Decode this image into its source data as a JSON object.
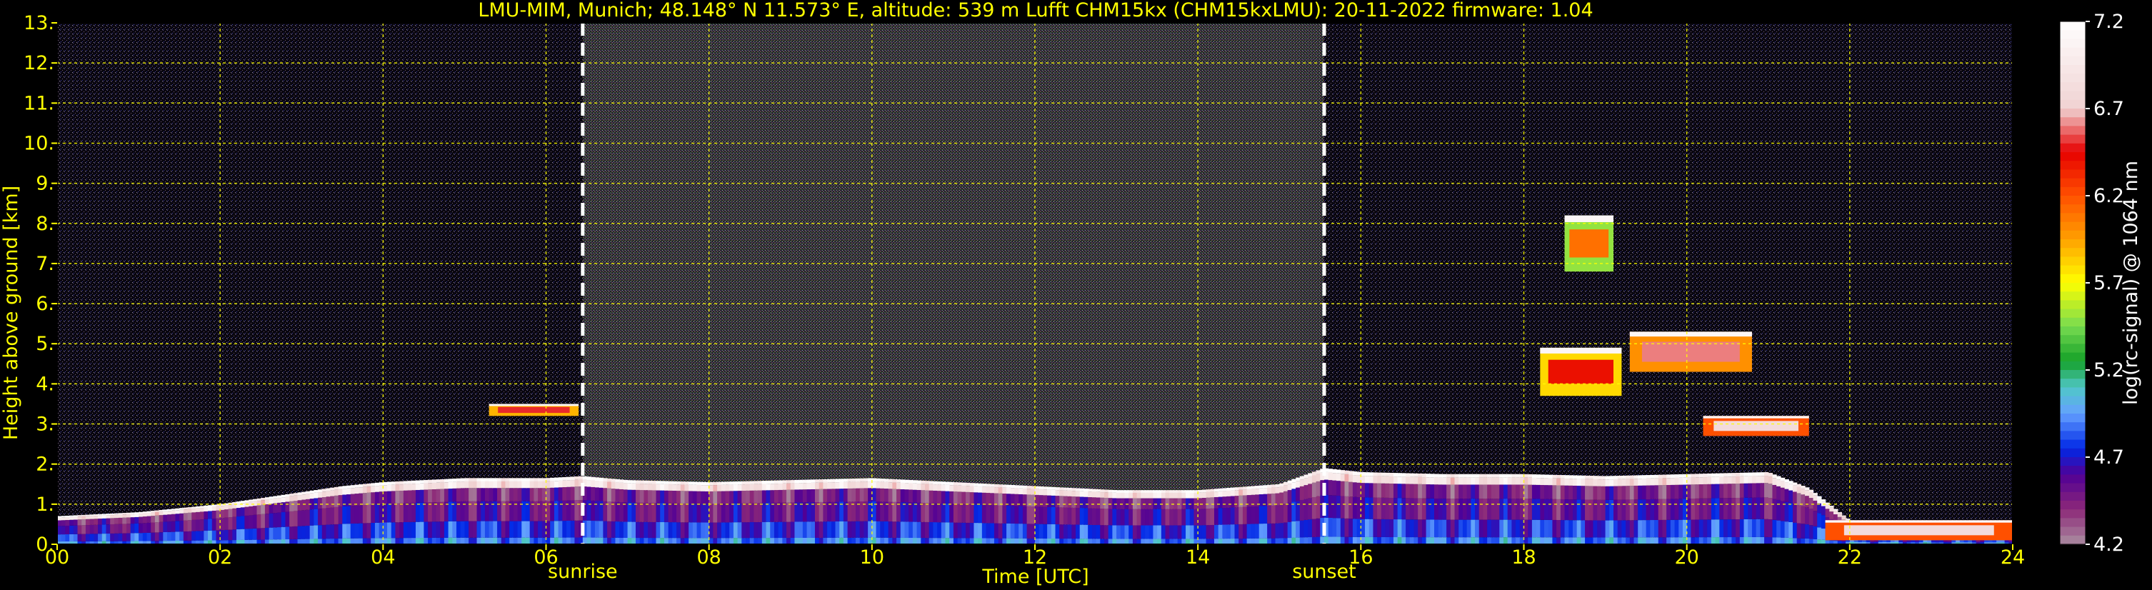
{
  "chart_data": {
    "type": "heatmap",
    "title": "LMU-MIM, Munich; 48.148° N 11.573° E, altitude: 539 m    Lufft CHM15kx (CHM15kxLMU): 20-11-2022    firmware: 1.04",
    "xlabel": "Time [UTC]",
    "ylabel": "Height above ground [km]",
    "colorbar_label": "log(rc-signal) @ 1064 nm",
    "xlim": [
      0,
      24
    ],
    "ylim": [
      0,
      13
    ],
    "x_ticks": [
      "00",
      "02",
      "04",
      "06",
      "08",
      "10",
      "12",
      "14",
      "16",
      "18",
      "20",
      "22",
      "24"
    ],
    "y_ticks": [
      "0.",
      "1.",
      "2.",
      "3.",
      "4.",
      "5.",
      "6.",
      "7.",
      "8.",
      "9.",
      "10.",
      "11.",
      "12.",
      "13."
    ],
    "colorbar_ticks": [
      "7.2",
      "6.7",
      "6.2",
      "5.7",
      "5.2",
      "4.7",
      "4.2"
    ],
    "colorbar_range": [
      4.2,
      7.2
    ],
    "grid": true,
    "events": [
      {
        "label": "sunrise",
        "time": 6.45
      },
      {
        "label": "sunset",
        "time": 15.55
      }
    ],
    "boundary_layer_top_km": [
      [
        0.0,
        0.7
      ],
      [
        0.5,
        0.75
      ],
      [
        1.0,
        0.8
      ],
      [
        1.5,
        0.9
      ],
      [
        2.0,
        1.0
      ],
      [
        2.5,
        1.15
      ],
      [
        3.0,
        1.3
      ],
      [
        3.5,
        1.45
      ],
      [
        4.0,
        1.55
      ],
      [
        5.0,
        1.65
      ],
      [
        6.0,
        1.65
      ],
      [
        6.45,
        1.7
      ],
      [
        7.0,
        1.6
      ],
      [
        8.0,
        1.55
      ],
      [
        9.0,
        1.6
      ],
      [
        10.0,
        1.65
      ],
      [
        11.0,
        1.55
      ],
      [
        12.0,
        1.45
      ],
      [
        13.0,
        1.35
      ],
      [
        14.0,
        1.35
      ],
      [
        15.0,
        1.5
      ],
      [
        15.55,
        1.9
      ],
      [
        16.0,
        1.8
      ],
      [
        17.0,
        1.75
      ],
      [
        18.0,
        1.75
      ],
      [
        19.0,
        1.7
      ],
      [
        20.0,
        1.75
      ],
      [
        21.0,
        1.8
      ],
      [
        21.5,
        1.4
      ],
      [
        22.0,
        0.6
      ],
      [
        23.0,
        0.5
      ],
      [
        24.0,
        0.5
      ]
    ],
    "cloud_layers": [
      {
        "t_start": 5.3,
        "t_end": 6.4,
        "base_km": 3.2,
        "top_km": 3.5,
        "level": 6.5
      },
      {
        "t_start": 18.2,
        "t_end": 19.2,
        "base_km": 3.7,
        "top_km": 4.9,
        "level": 6.4
      },
      {
        "t_start": 19.3,
        "t_end": 20.8,
        "base_km": 4.3,
        "top_km": 5.3,
        "level": 6.6
      },
      {
        "t_start": 20.2,
        "t_end": 21.5,
        "base_km": 2.7,
        "top_km": 3.2,
        "level": 6.8
      },
      {
        "t_start": 18.5,
        "t_end": 19.1,
        "base_km": 6.8,
        "top_km": 8.2,
        "level": 6.1
      },
      {
        "t_start": 21.7,
        "t_end": 24.0,
        "base_km": 0.1,
        "top_km": 0.6,
        "level": 6.8
      }
    ]
  }
}
